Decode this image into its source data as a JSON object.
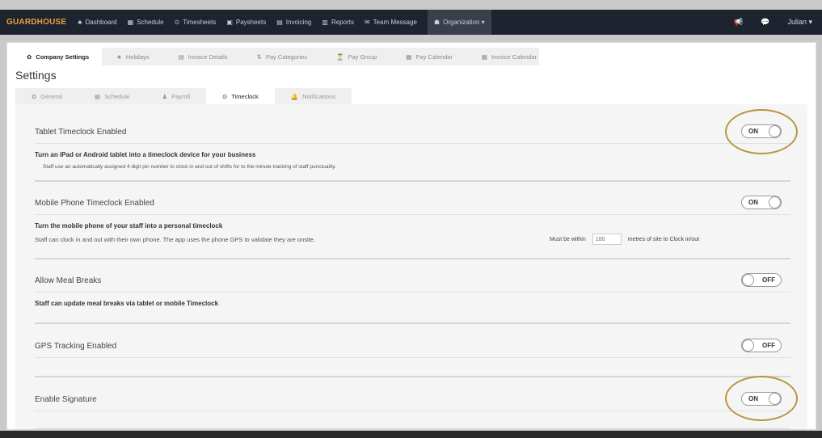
{
  "topbar": {
    "brand": "GUARDHOUSE",
    "nav": [
      {
        "icon": "♣",
        "label": "Dashboard"
      },
      {
        "icon": "▦",
        "label": "Schedule"
      },
      {
        "icon": "⊙",
        "label": "Timesheets"
      },
      {
        "icon": "▣",
        "label": "Paysheets"
      },
      {
        "icon": "▤",
        "label": "Invoicing"
      },
      {
        "icon": "▥",
        "label": "Reports"
      },
      {
        "icon": "✉",
        "label": "Team Message"
      },
      {
        "icon": "☗",
        "label": "Organization ▾"
      }
    ],
    "user": "Julian ▾",
    "megaphone_icon": "📢",
    "chat_icon": "💬"
  },
  "page_tabs": [
    {
      "icon": "✿",
      "label": "Company Settings"
    },
    {
      "icon": "★",
      "label": "Holidays"
    },
    {
      "icon": "▤",
      "label": "Invoice Details"
    },
    {
      "icon": "⇅",
      "label": "Pay Categories"
    },
    {
      "icon": "⏳",
      "label": "Pay Group"
    },
    {
      "icon": "▦",
      "label": "Pay Calendar"
    },
    {
      "icon": "▦",
      "label": "Invoice Calendar"
    }
  ],
  "settings_title": "Settings",
  "sub_tabs": [
    {
      "icon": "✿",
      "label": "General"
    },
    {
      "icon": "▦",
      "label": "Schedule"
    },
    {
      "icon": "♟",
      "label": "Payroll"
    },
    {
      "icon": "⊙",
      "label": "Timeclock"
    },
    {
      "icon": "🔔",
      "label": "Notifications"
    }
  ],
  "sections": {
    "tablet": {
      "title": "Tablet Timeclock Enabled",
      "bold": "Turn an iPad or Android tablet into a timeclock device for your business",
      "desc": "Staff use an automatically assigned 4 digit pin number to clock in and out of shifts for to the minute tracking of staff punctuality.",
      "toggle": "ON"
    },
    "mobile": {
      "title": "Mobile Phone Timeclock Enabled",
      "bold": "Turn the mobile phone of your staff into a personal timeclock",
      "desc": "Staff can clock in and out with their own phone. The app uses the phone GPS to validate they are onsite.",
      "within_label": "Must be within",
      "within_value": "100",
      "within_suffix": "metres of site to Clock in/out",
      "toggle": "ON"
    },
    "meal": {
      "title": "Allow Meal Breaks",
      "bold": "Staff can update meal breaks via tablet or mobile Timeclock",
      "toggle": "OFF"
    },
    "gps": {
      "title": "GPS Tracking Enabled",
      "toggle": "OFF"
    },
    "signature": {
      "title": "Enable Signature",
      "toggle": "ON"
    }
  },
  "colors": {
    "topbar": "#1e2330",
    "brand": "#e8a33a",
    "highlight_ring": "#b8963e"
  }
}
